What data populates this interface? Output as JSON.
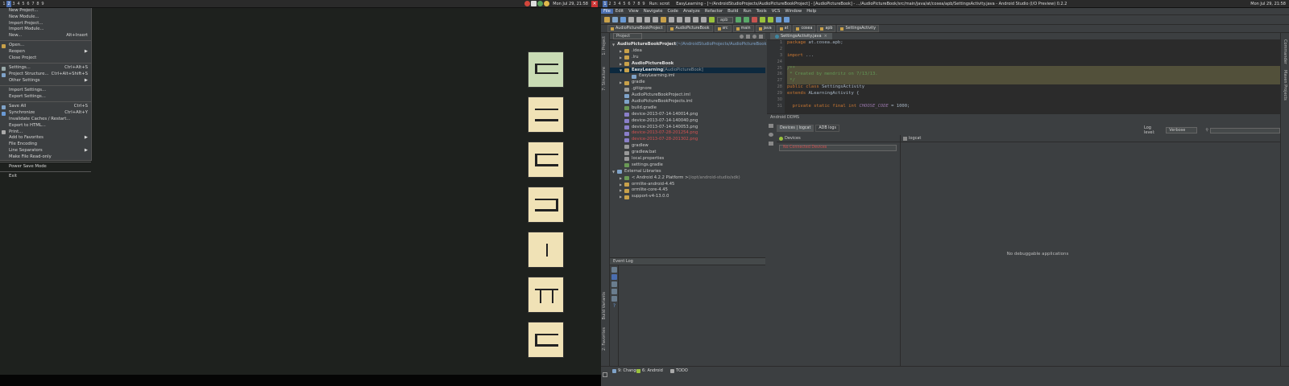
{
  "left_topbar": {
    "workspaces": [
      "1",
      "2",
      "3",
      "4",
      "5",
      "6",
      "7",
      "8",
      "9"
    ],
    "active_workspace": "2",
    "clock": "Mon Jul 29, 21:58"
  },
  "file_menu": {
    "items": [
      {
        "label": "New Project...",
        "shortcut": "",
        "icon": ""
      },
      {
        "label": "New Module...",
        "shortcut": "",
        "icon": ""
      },
      {
        "label": "Import Project...",
        "shortcut": "",
        "icon": ""
      },
      {
        "label": "Import Module...",
        "shortcut": "",
        "icon": ""
      },
      {
        "label": "New...",
        "shortcut": "Alt+Insert",
        "icon": ""
      },
      {
        "sep": true
      },
      {
        "label": "Open...",
        "shortcut": "",
        "icon": "folder"
      },
      {
        "label": "Reopen",
        "shortcut": "▶",
        "icon": ""
      },
      {
        "label": "Close Project",
        "shortcut": "",
        "icon": ""
      },
      {
        "sep": true
      },
      {
        "label": "Settings...",
        "shortcut": "Ctrl+Alt+S",
        "icon": "gear"
      },
      {
        "label": "Project Structure...",
        "shortcut": "Ctrl+Alt+Shift+S",
        "icon": "structure"
      },
      {
        "label": "Other Settings",
        "shortcut": "▶",
        "icon": ""
      },
      {
        "sep": true
      },
      {
        "label": "Import Settings...",
        "shortcut": "",
        "icon": ""
      },
      {
        "label": "Export Settings...",
        "shortcut": "",
        "icon": ""
      },
      {
        "sep": true
      },
      {
        "label": "Save All",
        "shortcut": "Ctrl+S",
        "icon": "save"
      },
      {
        "label": "Synchronize",
        "shortcut": "Ctrl+Alt+Y",
        "icon": "sync"
      },
      {
        "label": "Invalidate Caches / Restart...",
        "shortcut": "",
        "icon": ""
      },
      {
        "label": "Export to HTML...",
        "shortcut": "",
        "icon": ""
      },
      {
        "label": "Print...",
        "shortcut": "",
        "icon": "print"
      },
      {
        "label": "Add to Favorites",
        "shortcut": "▶",
        "icon": ""
      },
      {
        "label": "File Encoding",
        "shortcut": "",
        "icon": ""
      },
      {
        "label": "Line Separators",
        "shortcut": "▶",
        "icon": ""
      },
      {
        "label": "Make File Read-only",
        "shortcut": "",
        "icon": ""
      },
      {
        "sep": true
      },
      {
        "label": "Power Save Mode",
        "shortcut": "",
        "icon": ""
      },
      {
        "sep": true
      },
      {
        "label": "Exit",
        "shortcut": "",
        "icon": ""
      }
    ]
  },
  "right_topbar": {
    "workspaces": [
      "1",
      "2",
      "3",
      "4",
      "5",
      "6",
      "7",
      "8",
      "9"
    ],
    "active_workspace": "1",
    "run_label": "Run: scrot",
    "window_title": "EasyLearning - [~/AndroidStudioProjects/AudioPictureBookProject] - [AudioPictureBook] - .../AudioPictureBook/src/main/java/at/cosea/apb/SettingsActivity.java - Android Studio (I/O Preview) 0.2.2",
    "clock": "Mon Jul 29, 21:58"
  },
  "colors": {
    "accent": "#4b6eaf",
    "tile": "#f0e2b6",
    "tile_first": "#c9dbb4",
    "error_red": "#d25252"
  },
  "menubar": [
    "File",
    "Edit",
    "View",
    "Navigate",
    "Code",
    "Analyze",
    "Refactor",
    "Build",
    "Run",
    "Tools",
    "VCS",
    "Window",
    "Help"
  ],
  "toolbar": {
    "config_label": "apb"
  },
  "navbar": {
    "crumbs": [
      "AudioPictureBookProject",
      "AudioPictureBook",
      "src",
      "main",
      "java",
      "at",
      "cosea",
      "apb",
      "SettingsActivity"
    ]
  },
  "project_panel": {
    "header": "Project",
    "tree": [
      {
        "indent": 0,
        "arrow": "▼",
        "label": "AudioPictureBookProject",
        "extra": " (~/AndroidStudioProjects/AudioPictureBookProject)",
        "bold": true,
        "color": "#c9a14a",
        "style": ""
      },
      {
        "indent": 1,
        "arrow": "▶",
        "label": ".idea",
        "extra": "",
        "bold": false,
        "color": "#c9a14a",
        "style": ""
      },
      {
        "indent": 1,
        "arrow": "▶",
        "label": ".lru",
        "extra": "",
        "bold": false,
        "color": "#c9a14a",
        "style": ""
      },
      {
        "indent": 1,
        "arrow": "▶",
        "label": "AudioPictureBook",
        "extra": "",
        "bold": true,
        "color": "#c9a14a",
        "style": ""
      },
      {
        "indent": 1,
        "arrow": "▼",
        "label": "EasyLearning",
        "extra": " [AudioPictureBook]",
        "bold": true,
        "color": "#c9a14a",
        "style": "sel"
      },
      {
        "indent": 2,
        "arrow": "",
        "label": "EasyLearning.iml",
        "extra": "",
        "bold": false,
        "color": "#7fa3c9",
        "style": ""
      },
      {
        "indent": 1,
        "arrow": "▶",
        "label": "gradle",
        "extra": "",
        "bold": false,
        "color": "#c9a14a",
        "style": ""
      },
      {
        "indent": 1,
        "arrow": "",
        "label": ".gitignore",
        "extra": "",
        "bold": false,
        "color": "#999",
        "style": ""
      },
      {
        "indent": 1,
        "arrow": "",
        "label": "AudioPictureBookProject.iml",
        "extra": "",
        "bold": false,
        "color": "#7fa3c9",
        "style": ""
      },
      {
        "indent": 1,
        "arrow": "",
        "label": "AudioPictureBookProjects.iml",
        "extra": "",
        "bold": false,
        "color": "#7fa3c9",
        "style": ""
      },
      {
        "indent": 1,
        "arrow": "",
        "label": "build.gradle",
        "extra": "",
        "bold": false,
        "color": "#6a9955",
        "style": ""
      },
      {
        "indent": 1,
        "arrow": "",
        "label": "device-2013-07-14-140014.png",
        "extra": "",
        "bold": false,
        "color": "#8a7fc9",
        "style": ""
      },
      {
        "indent": 1,
        "arrow": "",
        "label": "device-2013-07-14-140040.png",
        "extra": "",
        "bold": false,
        "color": "#8a7fc9",
        "style": ""
      },
      {
        "indent": 1,
        "arrow": "",
        "label": "device-2013-07-14-140053.png",
        "extra": "",
        "bold": false,
        "color": "#8a7fc9",
        "style": ""
      },
      {
        "indent": 1,
        "arrow": "",
        "label": "device-2013-07-28-201254.png",
        "extra": "",
        "bold": false,
        "color": "#8a7fc9",
        "style": "red"
      },
      {
        "indent": 1,
        "arrow": "",
        "label": "device-2013-07-28-201302.png",
        "extra": "",
        "bold": false,
        "color": "#8a7fc9",
        "style": "red"
      },
      {
        "indent": 1,
        "arrow": "",
        "label": "gradlew",
        "extra": "",
        "bold": false,
        "color": "#999",
        "style": ""
      },
      {
        "indent": 1,
        "arrow": "",
        "label": "gradlew.bat",
        "extra": "",
        "bold": false,
        "color": "#999",
        "style": ""
      },
      {
        "indent": 1,
        "arrow": "",
        "label": "local.properties",
        "extra": "",
        "bold": false,
        "color": "#999",
        "style": ""
      },
      {
        "indent": 1,
        "arrow": "",
        "label": "settings.gradle",
        "extra": "",
        "bold": false,
        "color": "#6a9955",
        "style": ""
      },
      {
        "indent": 0,
        "arrow": "▼",
        "label": "External Libraries",
        "extra": "",
        "bold": false,
        "color": "#7fa3c9",
        "style": ""
      },
      {
        "indent": 1,
        "arrow": "▶",
        "label": "< Android 4.2.2 Platform >",
        "extra": " (/opt/android-studio/sdk)",
        "bold": false,
        "color": "#6a9955",
        "style": ""
      },
      {
        "indent": 1,
        "arrow": "▶",
        "label": "ormlite-android-4.45",
        "extra": "",
        "bold": false,
        "color": "#c9a14a",
        "style": ""
      },
      {
        "indent": 1,
        "arrow": "▶",
        "label": "ormlite-core-4.45",
        "extra": "",
        "bold": false,
        "color": "#c9a14a",
        "style": ""
      },
      {
        "indent": 1,
        "arrow": "▶",
        "label": "support-v4-13.0.0",
        "extra": "",
        "bold": false,
        "color": "#c9a14a",
        "style": ""
      }
    ]
  },
  "editor": {
    "tab": "SettingsActivity.java",
    "lines": [
      {
        "n": "1",
        "text": "package at.cosea.apb;",
        "cls": ""
      },
      {
        "n": "2",
        "text": "",
        "cls": ""
      },
      {
        "n": "3",
        "text": "import ...",
        "cls": ""
      },
      {
        "n": "24",
        "text": "",
        "cls": ""
      },
      {
        "n": "25",
        "text": "/**",
        "cls": "cm"
      },
      {
        "n": "26",
        "text": " * Created by mendritz on 7/13/13.",
        "cls": "cm"
      },
      {
        "n": "27",
        "text": " */",
        "cls": "cm"
      },
      {
        "n": "28",
        "text": "public class SettingsActivity",
        "cls": ""
      },
      {
        "n": "29",
        "text": "extends ALearningActivity {",
        "cls": ""
      },
      {
        "n": "30",
        "text": "",
        "cls": ""
      },
      {
        "n": "31",
        "text": "  private static final int CHOOSE_CODE = 1000;",
        "cls": ""
      }
    ]
  },
  "event_log": {
    "title": "Event Log"
  },
  "ddms": {
    "title": "Android DDMS",
    "tabs": [
      "Devices | logcat",
      "ADB logs"
    ],
    "log_level_label": "Log level:",
    "log_level": "Verbose",
    "search_placeholder": "",
    "devices_title": "Devices",
    "no_devices": "No Connected Devices",
    "logcat_title": "logcat",
    "no_debug": "No debuggable applications"
  },
  "bottom_tabs": [
    {
      "label": "9: Changes",
      "icon": "changes"
    },
    {
      "label": "6: Android",
      "icon": "android"
    },
    {
      "label": "TODO",
      "icon": "todo"
    }
  ],
  "left_strip_labels": [
    "1: Project",
    "7: Structure",
    "Build Variants",
    "2: Favorites"
  ],
  "right_strip_labels": [
    "Commander",
    "Maven Projects"
  ]
}
